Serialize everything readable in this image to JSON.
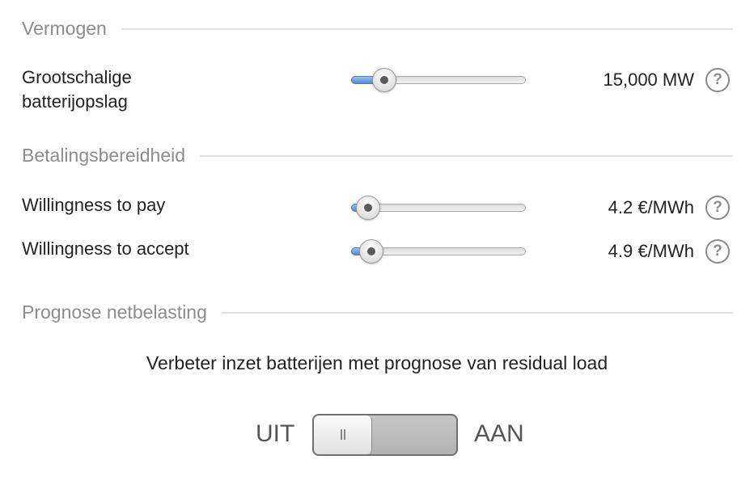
{
  "sections": {
    "capacity": {
      "title": "Vermogen"
    },
    "willingness": {
      "title": "Betalingsbereidheid"
    },
    "forecast": {
      "title": "Prognose netbelasting"
    }
  },
  "battery_storage": {
    "label_line1": "Grootschalige",
    "label_line2": "batterijopslag",
    "value": "15,000 MW",
    "slider_fraction": 0.19
  },
  "willingness_to_pay": {
    "label": "Willingness to pay",
    "value": "4.2 €/MWh",
    "slider_fraction": 0.095
  },
  "willingness_to_accept": {
    "label": "Willingness to accept",
    "value": "4.9 €/MWh",
    "slider_fraction": 0.115
  },
  "forecast_toggle": {
    "description": "Verbeter inzet batterijen met prognose van residual load",
    "off_label": "UIT",
    "on_label": "AAN",
    "state": "off",
    "thumb_glyph": "II"
  },
  "help_icon_glyph": "?",
  "colors": {
    "slider_fill": "#4d8dd0",
    "section_title": "#8c8c8c"
  }
}
